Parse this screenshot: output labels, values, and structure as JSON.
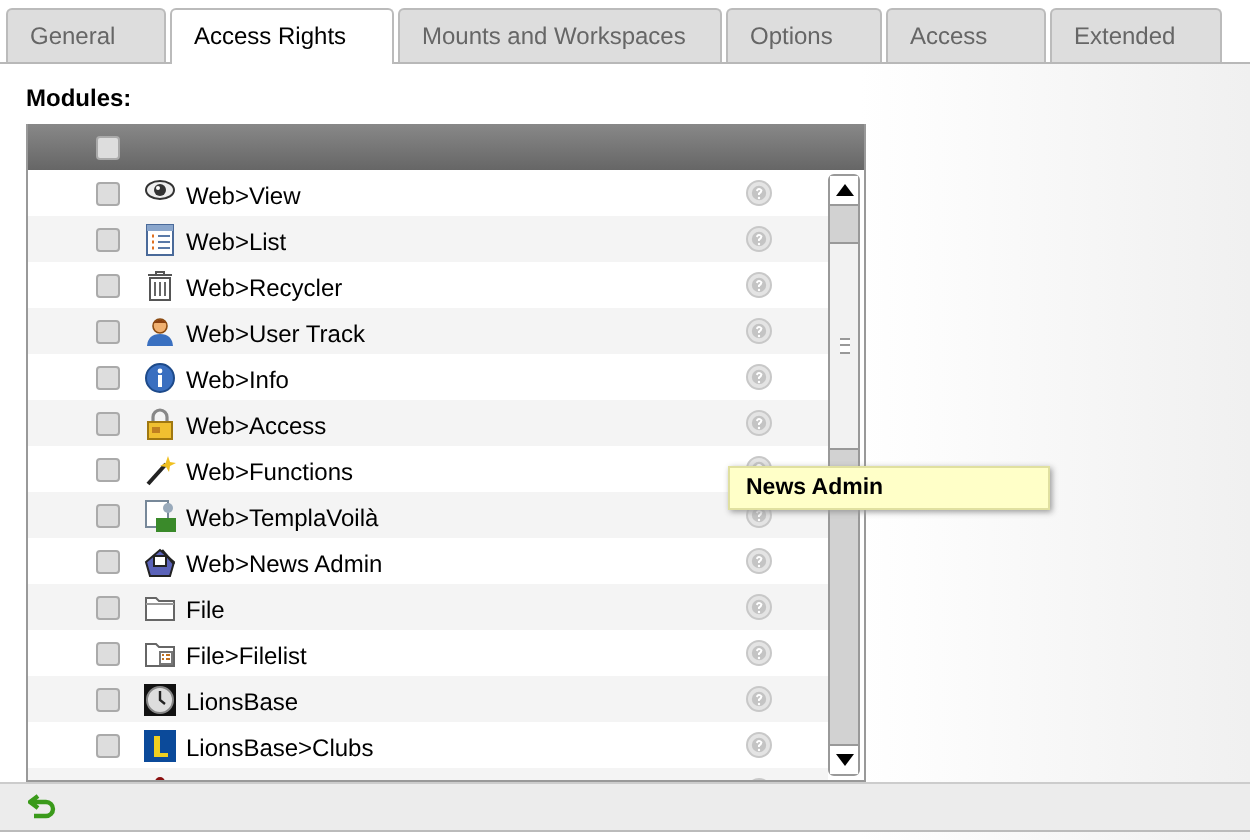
{
  "tabs": [
    {
      "label": "General",
      "selected": false
    },
    {
      "label": "Access Rights",
      "selected": true
    },
    {
      "label": "Mounts and Workspaces",
      "selected": false
    },
    {
      "label": "Options",
      "selected": false
    },
    {
      "label": "Access",
      "selected": false
    },
    {
      "label": "Extended",
      "selected": false
    }
  ],
  "section_label": "Modules:",
  "header_checkbox": {
    "checked": false
  },
  "rows": [
    {
      "label": "Web>View",
      "kind": "eye",
      "checked": false
    },
    {
      "label": "Web>List",
      "kind": "list",
      "checked": false
    },
    {
      "label": "Web>Recycler",
      "kind": "trash",
      "checked": false
    },
    {
      "label": "Web>User Track",
      "kind": "user",
      "checked": false
    },
    {
      "label": "Web>Info",
      "kind": "info",
      "checked": false
    },
    {
      "label": "Web>Access",
      "kind": "lock",
      "checked": false
    },
    {
      "label": "Web>Functions",
      "kind": "wand",
      "checked": false
    },
    {
      "label": "Web>TemplaVoilà",
      "kind": "template",
      "checked": false
    },
    {
      "label": "Web>News Admin",
      "kind": "news",
      "checked": false
    },
    {
      "label": "File",
      "kind": "folder",
      "checked": false
    },
    {
      "label": "File>Filelist",
      "kind": "filelist",
      "checked": false
    },
    {
      "label": "LionsBase",
      "kind": "clock",
      "checked": false
    },
    {
      "label": "LionsBase>Clubs",
      "kind": "letter",
      "checked": false
    },
    {
      "kind": "dot"
    }
  ],
  "tooltip": {
    "text": "News Admin"
  }
}
